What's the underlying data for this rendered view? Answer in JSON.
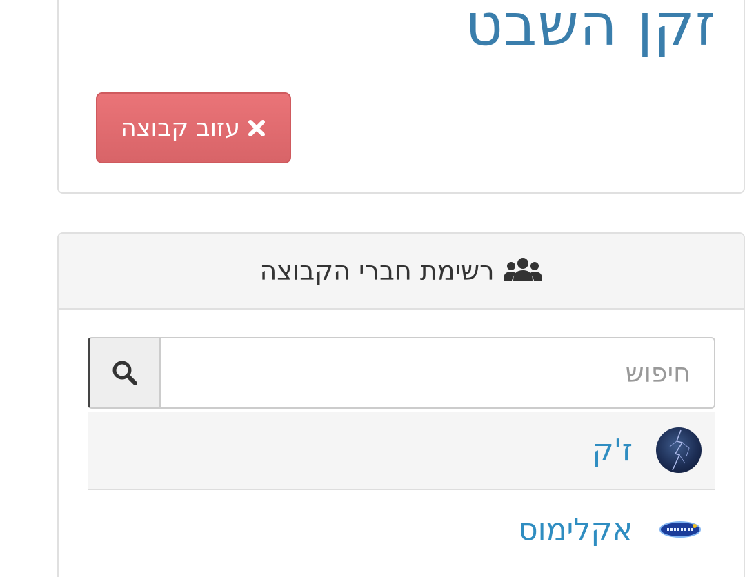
{
  "group": {
    "title": "זקן השבט",
    "leave_button_label": "עזוב קבוצה",
    "leave_button_icon": "close-icon"
  },
  "members": {
    "header_title": "רשימת חברי הקבוצה",
    "header_icon": "users-icon",
    "search": {
      "placeholder": "חיפוש",
      "value": "",
      "button_icon": "search-icon"
    },
    "items": [
      {
        "name": "ז'ק",
        "avatar": "lightning-avatar"
      },
      {
        "name": "אקלימוס",
        "avatar": "logo-avatar"
      }
    ]
  },
  "colors": {
    "title": "#3a7eac",
    "danger_button": "#e46a6e",
    "link": "#2f8dc1",
    "header_bg": "#f5f5f5"
  }
}
